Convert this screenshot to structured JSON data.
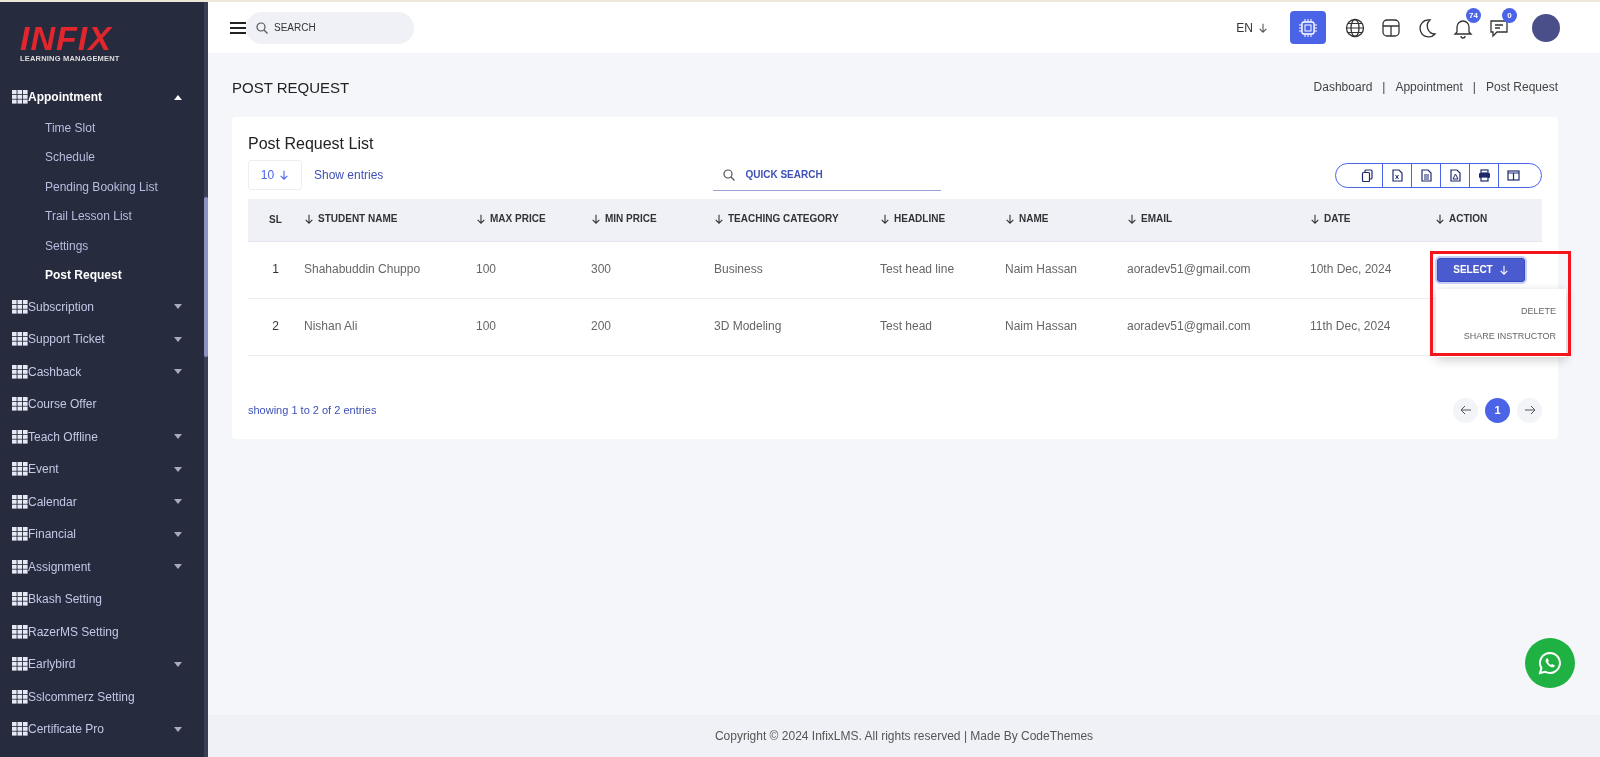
{
  "sidebar": {
    "logo": {
      "title": "INFIX",
      "subtitle": "LEARNING MANAGEMENT"
    },
    "items": [
      {
        "label": "Appointment",
        "expandable": true,
        "expanded": true,
        "children": [
          {
            "label": "Time Slot",
            "selected": false
          },
          {
            "label": "Schedule",
            "selected": false
          },
          {
            "label": "Pending Booking List",
            "selected": false
          },
          {
            "label": "Trail Lesson List",
            "selected": false
          },
          {
            "label": "Settings",
            "selected": false
          },
          {
            "label": "Post Request",
            "selected": true
          }
        ]
      },
      {
        "label": "Subscription",
        "expandable": true,
        "expanded": false
      },
      {
        "label": "Support Ticket",
        "expandable": true,
        "expanded": false
      },
      {
        "label": "Cashback",
        "expandable": true,
        "expanded": false
      },
      {
        "label": "Course Offer",
        "expandable": false
      },
      {
        "label": "Teach Offline",
        "expandable": true,
        "expanded": false
      },
      {
        "label": "Event",
        "expandable": true,
        "expanded": false
      },
      {
        "label": "Calendar",
        "expandable": true,
        "expanded": false
      },
      {
        "label": "Financial",
        "expandable": true,
        "expanded": false
      },
      {
        "label": "Assignment",
        "expandable": true,
        "expanded": false
      },
      {
        "label": "Bkash Setting",
        "expandable": false
      },
      {
        "label": "RazerMS Setting",
        "expandable": false
      },
      {
        "label": "Earlybird",
        "expandable": true,
        "expanded": false
      },
      {
        "label": "Sslcommerz Setting",
        "expandable": false
      },
      {
        "label": "Certificate Pro",
        "expandable": true,
        "expanded": false
      }
    ]
  },
  "topbar": {
    "search": {
      "placeholder": "SEARCH"
    },
    "language": "EN",
    "notifications": "74",
    "messages": "0"
  },
  "page": {
    "title": "POST REQUEST",
    "breadcrumbs": [
      "Dashboard",
      "Appointment",
      "Post Request"
    ],
    "breadcrumb_separator": "|"
  },
  "card": {
    "title": "Post Request List",
    "page_size": "10",
    "show_entries": "Show entries",
    "quick_search": {
      "placeholder": "QUICK SEARCH"
    },
    "table": {
      "columns": [
        {
          "label": "SL",
          "sortable": false
        },
        {
          "label": "STUDENT NAME",
          "sortable": true
        },
        {
          "label": "MAX PRICE",
          "sortable": true
        },
        {
          "label": "MIN PRICE",
          "sortable": true
        },
        {
          "label": "TEACHING CATEGORY",
          "sortable": true
        },
        {
          "label": "HEADLINE",
          "sortable": true
        },
        {
          "label": "NAME",
          "sortable": true
        },
        {
          "label": "EMAIL",
          "sortable": true
        },
        {
          "label": "DATE",
          "sortable": true
        },
        {
          "label": "ACTION",
          "sortable": true
        }
      ],
      "rows": [
        {
          "cells": [
            "1",
            "Shahabuddin Chuppo",
            "100",
            "300",
            "Business",
            "Test head line",
            "Naim Hassan",
            "aoradev51@gmail.com",
            "10th Dec, 2024"
          ],
          "action": {
            "label": "SELECT",
            "open": true,
            "menu": [
              "DELETE",
              "SHARE INSTRUCTOR"
            ]
          }
        },
        {
          "cells": [
            "2",
            "Nishan Ali",
            "100",
            "200",
            "3D Modeling",
            "Test head",
            "Naim Hassan",
            "aoradev51@gmail.com",
            "11th Dec, 2024"
          ]
        }
      ]
    },
    "info": "showing 1 to 2 of 2 entries",
    "pages": [
      {
        "label": "1",
        "selected": true
      }
    ]
  },
  "footer": "Copyright © 2024 InfixLMS. All rights reserved | Made By CodeThemes"
}
